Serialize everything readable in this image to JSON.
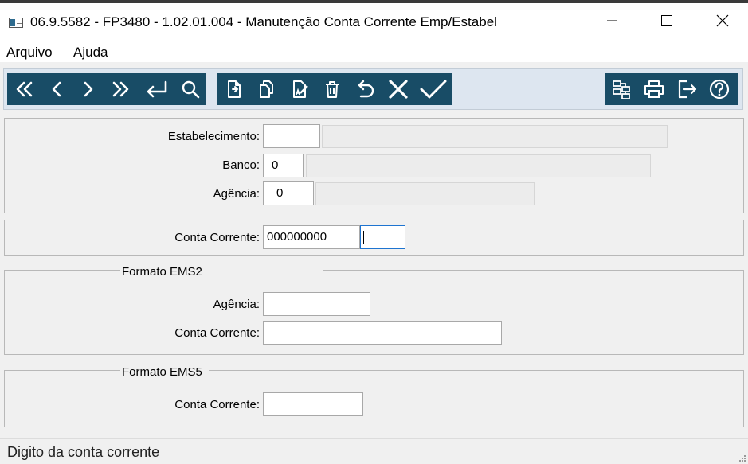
{
  "window": {
    "title": "06.9.5582 - FP3480 - 1.02.01.004 - Manutenção Conta Corrente Emp/Estabel"
  },
  "menu": {
    "arquivo": "Arquivo",
    "ajuda": "Ajuda"
  },
  "toolbar": {
    "accent": "#184c66",
    "nav_icons": [
      "first-icon",
      "previous-icon",
      "next-icon",
      "last-icon",
      "goto-icon",
      "search-icon"
    ],
    "edit_icons": [
      "new-icon",
      "copy-icon",
      "edit-icon",
      "delete-icon",
      "undo-icon",
      "cancel-icon",
      "confirm-icon"
    ],
    "right_icons": [
      "navigate-tree-icon",
      "print-icon",
      "exit-icon",
      "help-icon"
    ]
  },
  "form": {
    "estabelecimento": {
      "label": "Estabelecimento:",
      "value": "",
      "description": ""
    },
    "banco": {
      "label": "Banco:",
      "value": "0",
      "description": ""
    },
    "agencia": {
      "label": "Agência:",
      "value": "0",
      "description": ""
    },
    "conta_corrente": {
      "label": "Conta Corrente:",
      "value": "000000000",
      "digito": ""
    },
    "ems2": {
      "title": "Formato EMS2",
      "agencia_label": "Agência:",
      "agencia_value": "",
      "conta_label": "Conta Corrente:",
      "conta_value": ""
    },
    "ems5": {
      "title": "Formato EMS5",
      "conta_label": "Conta Corrente:",
      "conta_value": ""
    }
  },
  "status": {
    "text": "Digito da conta corrente"
  }
}
